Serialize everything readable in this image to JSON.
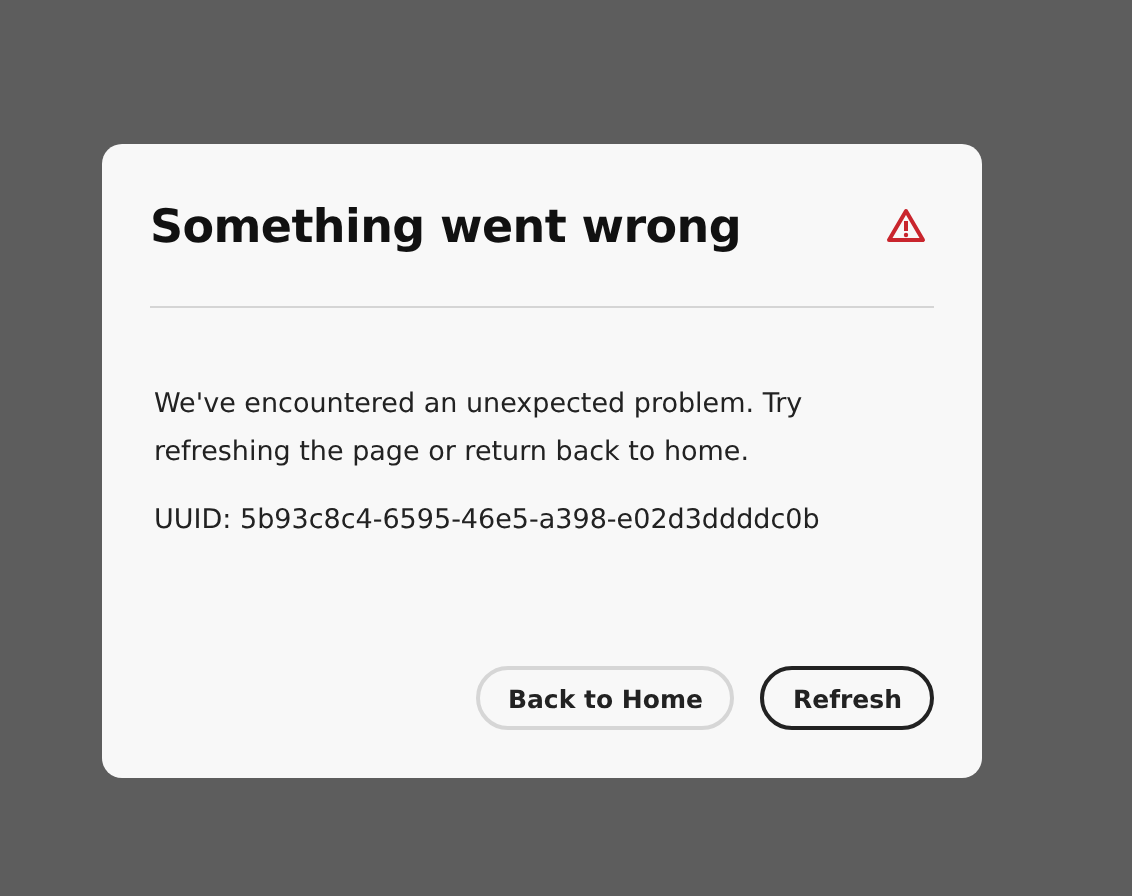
{
  "dialog": {
    "title": "Something went wrong",
    "message": "We've encountered an unexpected problem. Try refreshing the page or return back to home.",
    "uuid": "UUID: 5b93c8c4-6595-46e5-a398-e02d3ddddc0b",
    "buttons": [
      {
        "label": "Back to Home",
        "kind": "secondary"
      },
      {
        "label": "Refresh",
        "kind": "primary"
      }
    ]
  }
}
